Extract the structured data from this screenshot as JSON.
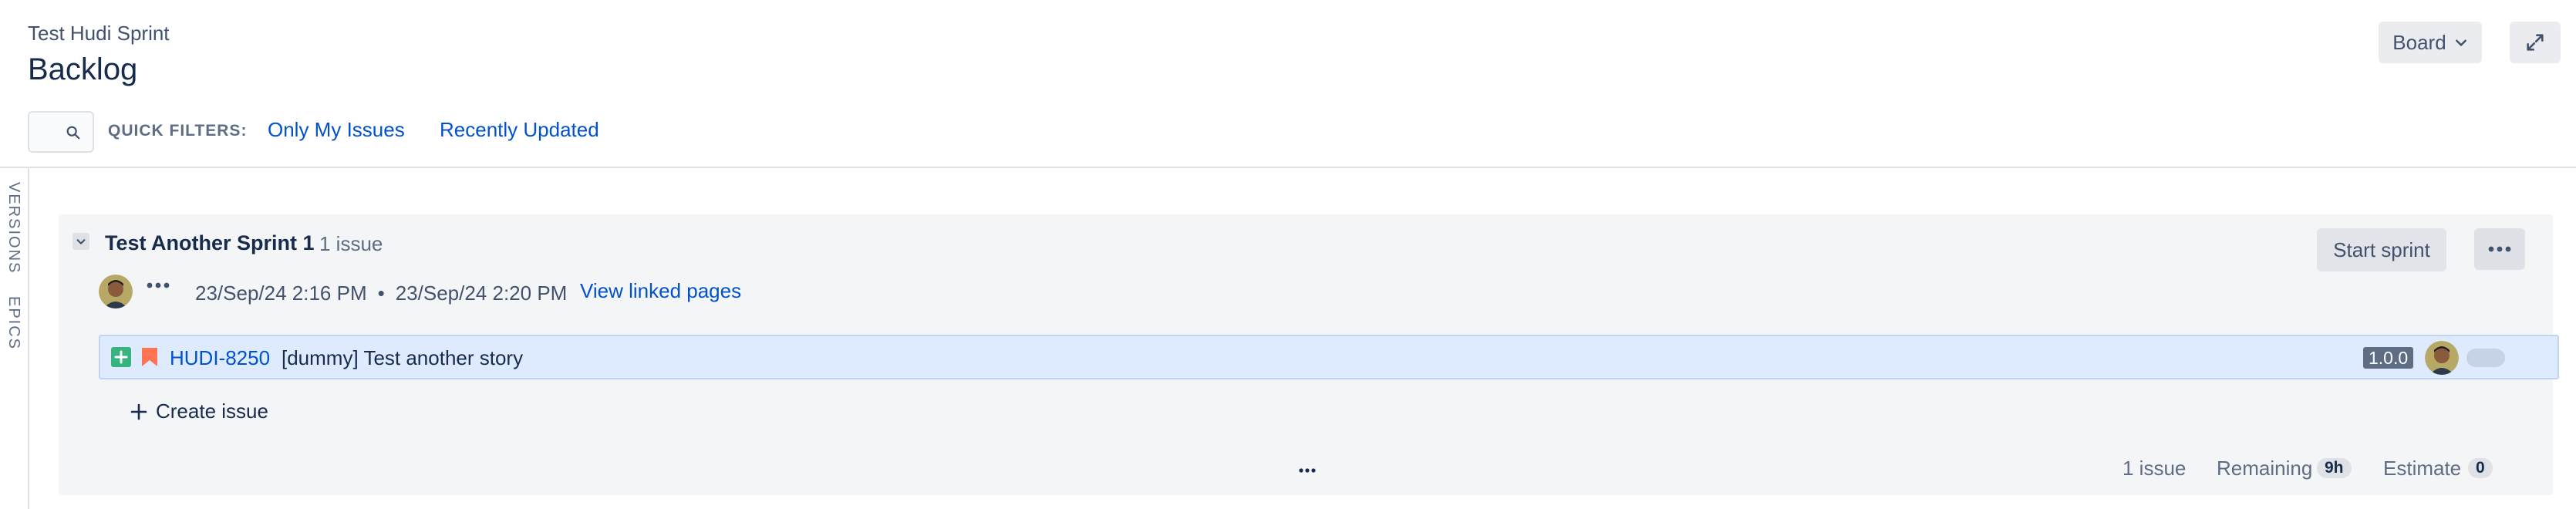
{
  "header": {
    "project_name": "Test Hudi Sprint",
    "page_title": "Backlog",
    "board_button_label": "Board",
    "board_chevron_icon": "chevron-down-icon",
    "expand_icon": "fullscreen-expand-icon"
  },
  "filters": {
    "search_icon": "search-icon",
    "search_value": "",
    "quick_filters_label": "QUICK FILTERS:",
    "items": [
      {
        "label": "Only My Issues"
      },
      {
        "label": "Recently Updated"
      }
    ]
  },
  "side_rail": {
    "tabs": [
      {
        "label": "VERSIONS"
      },
      {
        "label": "EPICS"
      }
    ]
  },
  "sprint": {
    "name": "Test Another Sprint 1",
    "issue_count": "1 issue",
    "start_date": "23/Sep/24 2:16 PM",
    "separator": "•",
    "end_date": "23/Sep/24 2:20 PM",
    "linked_pages_label": "View linked pages",
    "start_sprint_label": "Start sprint",
    "more_icon": "more-horizontal-icon",
    "issues": [
      {
        "type_icon": "story-icon",
        "priority_icon": "priority-highest-icon",
        "key": "HUDI-8250",
        "summary": "[dummy] Test another story",
        "fix_version": "1.0.0"
      }
    ],
    "create_issue_label": "Create issue",
    "footer": {
      "issue_count": "1 issue",
      "remaining_label": "Remaining",
      "remaining_value": "9h",
      "estimate_label": "Estimate",
      "estimate_value": "0"
    }
  },
  "colors": {
    "link": "#0052cc",
    "text": "#172b4d",
    "subtle_text": "#5e6c84",
    "panel_bg": "#f4f5f7",
    "selected_row_bg": "#deebff",
    "story_green": "#36b37e",
    "priority_orange": "#ff7452"
  }
}
